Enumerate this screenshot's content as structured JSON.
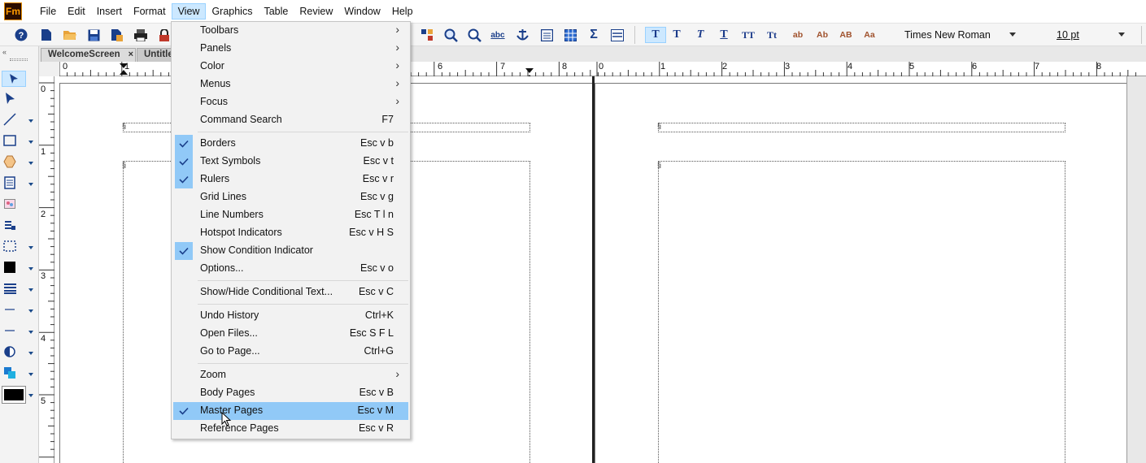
{
  "app": {
    "logo_text": "Fm"
  },
  "menubar": {
    "items": [
      "File",
      "Edit",
      "Insert",
      "Format",
      "View",
      "Graphics",
      "Table",
      "Review",
      "Window",
      "Help"
    ],
    "active": "View"
  },
  "toolbar": {
    "font_name": "Times New Roman",
    "font_size": "10 pt",
    "format_buttons": [
      "T",
      "T",
      "T",
      "T",
      "TT",
      "Tt",
      "ab",
      "Ab",
      "AB",
      "Aa"
    ],
    "spell_label": "abc"
  },
  "tabs": [
    {
      "label": "WelcomeScreen",
      "close": "×"
    },
    {
      "label": "Untitle"
    }
  ],
  "ruler_left": {
    "labels": [
      "0",
      "1"
    ]
  },
  "ruler_right": {
    "labels": [
      "6",
      "7",
      "8",
      "0",
      "1",
      "2",
      "3",
      "4",
      "5",
      "6",
      "7",
      "8"
    ]
  },
  "ruler_vertical": {
    "labels": [
      "0",
      "1",
      "2",
      "3",
      "4",
      "5"
    ]
  },
  "view_menu": {
    "items": [
      {
        "label": "Toolbars",
        "shortcut": "",
        "submenu": true,
        "checked": false
      },
      {
        "label": "Panels",
        "shortcut": "",
        "submenu": true,
        "checked": false
      },
      {
        "label": "Color",
        "shortcut": "",
        "submenu": true,
        "checked": false
      },
      {
        "label": "Menus",
        "shortcut": "",
        "submenu": true,
        "checked": false
      },
      {
        "label": "Focus",
        "shortcut": "",
        "submenu": true,
        "checked": false
      },
      {
        "label": "Command Search",
        "shortcut": "F7",
        "submenu": false,
        "checked": false
      },
      {
        "label": "Borders",
        "shortcut": "Esc v b",
        "submenu": false,
        "checked": true
      },
      {
        "label": "Text Symbols",
        "shortcut": "Esc v t",
        "submenu": false,
        "checked": true
      },
      {
        "label": "Rulers",
        "shortcut": "Esc v r",
        "submenu": false,
        "checked": true
      },
      {
        "label": "Grid Lines",
        "shortcut": "Esc v g",
        "submenu": false,
        "checked": false
      },
      {
        "label": "Line Numbers",
        "shortcut": "Esc T l n",
        "submenu": false,
        "checked": false
      },
      {
        "label": "Hotspot Indicators",
        "shortcut": "Esc v H S",
        "submenu": false,
        "checked": false
      },
      {
        "label": "Show Condition Indicator",
        "shortcut": "",
        "submenu": false,
        "checked": true
      },
      {
        "label": "Options...",
        "shortcut": "Esc v o",
        "submenu": false,
        "checked": false
      },
      {
        "label": "Show/Hide Conditional Text...",
        "shortcut": "Esc v C",
        "submenu": false,
        "checked": false
      },
      {
        "label": "Undo History",
        "shortcut": "Ctrl+K",
        "submenu": false,
        "checked": false
      },
      {
        "label": "Open Files...",
        "shortcut": "Esc S F L",
        "submenu": false,
        "checked": false
      },
      {
        "label": "Go to Page...",
        "shortcut": "Ctrl+G",
        "submenu": false,
        "checked": false
      },
      {
        "label": "Zoom",
        "shortcut": "",
        "submenu": true,
        "checked": false
      },
      {
        "label": "Body Pages",
        "shortcut": "Esc v B",
        "submenu": false,
        "checked": false
      },
      {
        "label": "Master Pages",
        "shortcut": "Esc v M",
        "submenu": false,
        "checked": true,
        "highlighted": true
      },
      {
        "label": "Reference Pages",
        "shortcut": "Esc v R",
        "submenu": false,
        "checked": false
      }
    ]
  },
  "colors": {
    "accent_highlight": "#91c9f7",
    "menu_active": "#cce8ff",
    "logo_bg": "#2b0d00",
    "logo_fg": "#ff9a00"
  }
}
